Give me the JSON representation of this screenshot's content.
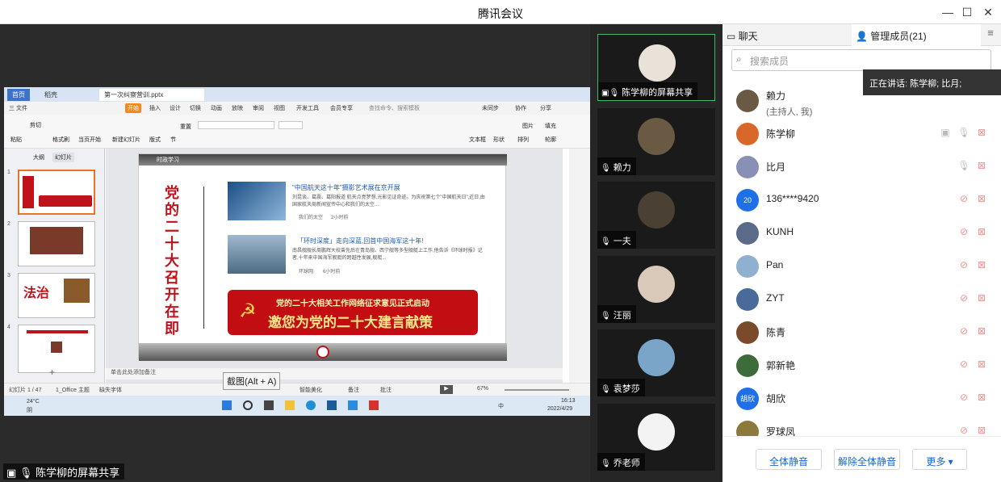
{
  "window": {
    "title": "腾讯会议"
  },
  "share": {
    "label": "陈学柳的屏幕共享",
    "tooltip": "截图(Alt + A)"
  },
  "ppt": {
    "tabs": [
      "首页",
      "稻壳",
      "第一次纠察营训.pptx"
    ],
    "menu": [
      "三 文件",
      "开始",
      "插入",
      "设计",
      "切换",
      "动画",
      "放映",
      "审阅",
      "视图",
      "开发工具",
      "会员专享",
      "查找命令、搜索模板",
      "未同步",
      "协作",
      "分享"
    ],
    "tools": [
      "粘贴",
      "剪切",
      "格式刷",
      "当页开始",
      "新建幻灯片",
      "版式",
      "节",
      "重置",
      "文本框",
      "形状",
      "排列",
      "图片",
      "填充",
      "轮廓"
    ],
    "thumb_tabs": [
      "大纲",
      "幻灯片"
    ],
    "slide": {
      "section": "时政学习",
      "vertical_title": "党的二十大召开在即",
      "news": [
        {
          "title": "\"中国航天这十年\"摄影艺术展在京开展",
          "text": "刘昆谈、葛震、葛阳报道 航天点亮梦想,光影见证奇迹。为庆祝第七个\"中国航天日\",近日,由国家航天局新闻宣传中心和我们的太空...",
          "source": "我们的太空",
          "time": "2小时前"
        },
        {
          "title": "「环时深度」走向深蓝,回首中国海军这十年!",
          "text": "南昌舰舰长周鹏辉大校曾先后在青岛舰、西宁舰等多型舰艇上工作,他告诉《环球时报》记者,十年来中国海军舰艇的跨越性发展,舰艇...",
          "source": "环球网",
          "time": "6小时前"
        }
      ],
      "banner_line1": "党的二十大相关工作网络征求意见正式启动",
      "banner_line2": "邀您为党的二十大建言献策"
    },
    "note": "单击此处添加备注",
    "status": {
      "page": "幻灯片 1 / 47",
      "theme": "1_Office 主题",
      "font": "缺失字体",
      "beautify": "智能美化",
      "notes": "备注",
      "comments": "批注",
      "zoom": "67%"
    },
    "taskbar": {
      "temp": "24°C",
      "weather": "阴",
      "time": "16:13",
      "date": "2022/4/29",
      "ime": "中"
    }
  },
  "videos": [
    {
      "name": "陈学柳的屏幕共享",
      "color": "#e9e2d8",
      "active": true
    },
    {
      "name": "赖力",
      "color": "#6b5a43",
      "active": false
    },
    {
      "name": "一夫",
      "color": "#4a4033",
      "active": false
    },
    {
      "name": "汪丽",
      "color": "#d9c9b8",
      "active": false
    },
    {
      "name": "袁梦莎",
      "color": "#7aa5c9",
      "active": false
    },
    {
      "name": "乔老师",
      "color": "#f3f3f3",
      "active": false
    }
  ],
  "panel": {
    "tabs": {
      "chat": "聊天",
      "members": "管理成员(21)"
    },
    "search_placeholder": "搜索成员",
    "speaking": "正在讲话: 陈学柳; 比月;",
    "members": [
      {
        "name": "赖力",
        "sub": "(主持人, 我)",
        "avatar": "",
        "color": "#6b5a43",
        "share": false,
        "mic": "none",
        "cam": "none"
      },
      {
        "name": "陈学柳",
        "sub": "",
        "avatar": "",
        "color": "#d8672a",
        "share": true,
        "mic": "on",
        "cam": "off"
      },
      {
        "name": "比月",
        "sub": "",
        "avatar": "",
        "color": "#8a8fb5",
        "share": false,
        "mic": "on",
        "cam": "off"
      },
      {
        "name": "136****9420",
        "sub": "",
        "avatar": "20",
        "color": "#1f6fe8",
        "share": false,
        "mic": "off",
        "cam": "off"
      },
      {
        "name": "KUNH",
        "sub": "",
        "avatar": "",
        "color": "#5a6b8a",
        "share": false,
        "mic": "off",
        "cam": "off"
      },
      {
        "name": "Pan",
        "sub": "",
        "avatar": "",
        "color": "#8fb0cf",
        "share": false,
        "mic": "off",
        "cam": "off"
      },
      {
        "name": "ZYT",
        "sub": "",
        "avatar": "",
        "color": "#4a6a99",
        "share": false,
        "mic": "off",
        "cam": "off"
      },
      {
        "name": "陈青",
        "sub": "",
        "avatar": "",
        "color": "#7a4b2a",
        "share": false,
        "mic": "off",
        "cam": "off"
      },
      {
        "name": "郭新艳",
        "sub": "",
        "avatar": "",
        "color": "#3e6b3a",
        "share": false,
        "mic": "off",
        "cam": "off"
      },
      {
        "name": "胡欣",
        "sub": "",
        "avatar": "胡欣",
        "color": "#1f6fe8",
        "share": false,
        "mic": "off",
        "cam": "off"
      },
      {
        "name": "罗球凤",
        "sub": "",
        "avatar": "",
        "color": "#8b7a3a",
        "share": false,
        "mic": "off",
        "cam": "off"
      }
    ],
    "footer": {
      "mute_all": "全体静音",
      "unmute_all": "解除全体静音",
      "more": "更多 ▾"
    }
  }
}
